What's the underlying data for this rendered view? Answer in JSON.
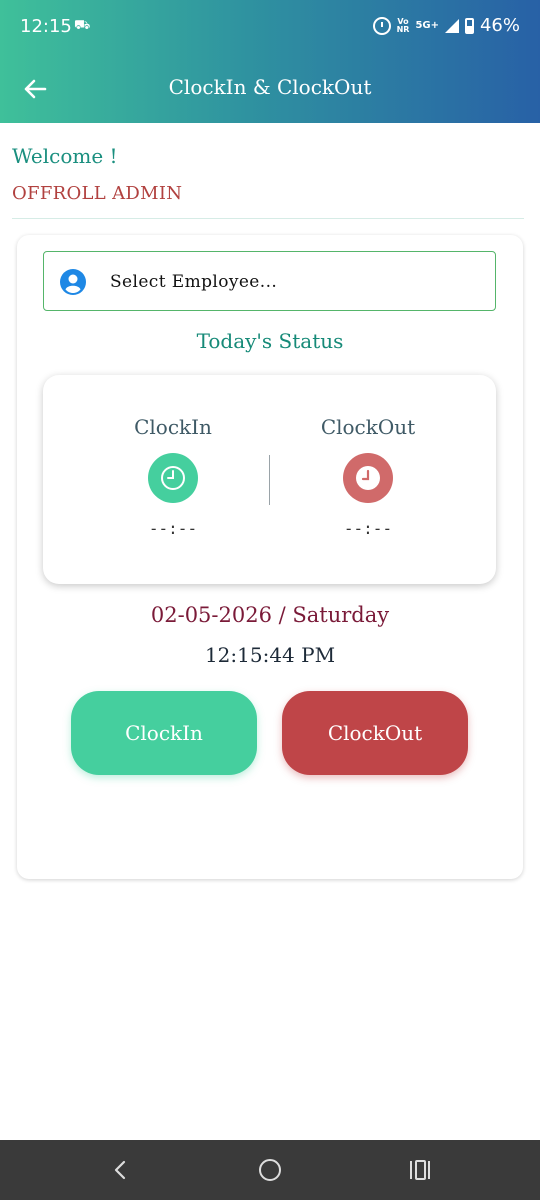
{
  "status_bar": {
    "time": "12:15",
    "car_icon": "car-icon",
    "network_top": "Vo",
    "network_bottom": "NR",
    "network_type": "5G+",
    "battery_percent": "46%"
  },
  "toolbar": {
    "title": "ClockIn & ClockOut",
    "back_icon": "arrow-left-icon"
  },
  "greeting": {
    "welcome": "Welcome !",
    "user_name": "OFFROLL ADMIN"
  },
  "employee_select": {
    "placeholder": "Select Employee...",
    "icon": "person-icon"
  },
  "status": {
    "title": "Today's Status",
    "clock_in_label": "ClockIn",
    "clock_in_time": "--:--",
    "clock_out_label": "ClockOut",
    "clock_out_time": "--:--"
  },
  "datetime": {
    "date": "02-05-2026 / Saturday",
    "time": "12:15:44 PM"
  },
  "actions": {
    "clock_in": "ClockIn",
    "clock_out": "ClockOut"
  },
  "colors": {
    "header_start": "#3fc09a",
    "header_end": "#2861a6",
    "clock_in": "#45cf9e",
    "clock_out": "#bf4548",
    "welcome": "#1a8f7f",
    "user_name": "#b1413f"
  }
}
